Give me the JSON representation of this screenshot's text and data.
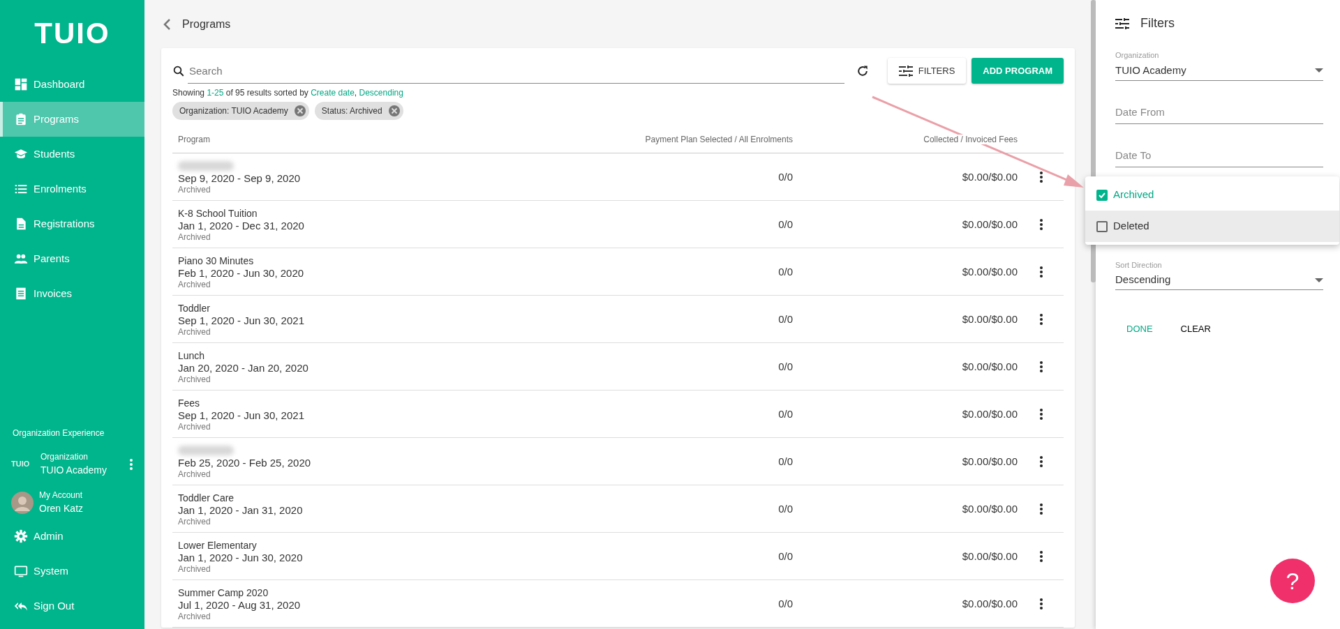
{
  "sidebar": {
    "logo": "TUIO",
    "items": [
      {
        "label": "Dashboard",
        "selected": false
      },
      {
        "label": "Programs",
        "selected": true
      },
      {
        "label": "Students",
        "selected": false
      },
      {
        "label": "Enrolments",
        "selected": false
      },
      {
        "label": "Registrations",
        "selected": false
      },
      {
        "label": "Parents",
        "selected": false
      },
      {
        "label": "Invoices",
        "selected": false
      }
    ],
    "section_title": "Organization Experience",
    "organization": {
      "logo": "TUIO",
      "label": "Organization",
      "name": "TUIO Academy"
    },
    "account": {
      "label": "My Account",
      "name": "Oren Katz"
    },
    "bottom_items": [
      {
        "label": "Admin"
      },
      {
        "label": "System"
      },
      {
        "label": "Sign Out"
      }
    ]
  },
  "header": {
    "title": "Programs"
  },
  "toolbar": {
    "search": {
      "placeholder": "Search"
    },
    "buttons": [
      {
        "label": "FILTERS",
        "kind": "outline"
      },
      {
        "label": "ADD PROGRAM",
        "kind": "primary"
      }
    ]
  },
  "summary": [
    {
      "text": "Showing ",
      "kind": "plain"
    },
    {
      "text": "1-25",
      "kind": "link"
    },
    {
      "text": " of 95 results sorted by ",
      "kind": "plain"
    },
    {
      "text": "Create date",
      "kind": "link"
    },
    {
      "text": ", ",
      "kind": "plain"
    },
    {
      "text": "Descending",
      "kind": "link"
    }
  ],
  "chips": [
    "Organization: TUIO Academy",
    "Status: Archived"
  ],
  "table": {
    "columns": [
      "Program",
      "Payment Plan Selected / All Enrolments",
      "Collected / Invoiced Fees"
    ],
    "rows": [
      {
        "redacted": true,
        "dates": "Sep 9, 2020 - Sep 9, 2020",
        "status": "Archived",
        "enrolments": "0/0",
        "fees": "$0.00/$0.00"
      },
      {
        "redacted": false,
        "name": "K-8 School Tuition",
        "dates": "Jan 1, 2020 - Dec 31, 2020",
        "status": "Archived",
        "enrolments": "0/0",
        "fees": "$0.00/$0.00"
      },
      {
        "redacted": false,
        "name": "Piano 30 Minutes",
        "dates": "Feb 1, 2020 - Jun 30, 2020",
        "status": "Archived",
        "enrolments": "0/0",
        "fees": "$0.00/$0.00"
      },
      {
        "redacted": false,
        "name": "Toddler",
        "dates": "Sep 1, 2020 - Jun 30, 2021",
        "status": "Archived",
        "enrolments": "0/0",
        "fees": "$0.00/$0.00"
      },
      {
        "redacted": false,
        "name": "Lunch",
        "dates": "Jan 20, 2020 - Jan 20, 2020",
        "status": "Archived",
        "enrolments": "0/0",
        "fees": "$0.00/$0.00"
      },
      {
        "redacted": false,
        "name": "Fees",
        "dates": "Sep 1, 2020 - Jun 30, 2021",
        "status": "Archived",
        "enrolments": "0/0",
        "fees": "$0.00/$0.00"
      },
      {
        "redacted": true,
        "dates": "Feb 25, 2020 - Feb 25, 2020",
        "status": "Archived",
        "enrolments": "0/0",
        "fees": "$0.00/$0.00"
      },
      {
        "redacted": false,
        "name": "Toddler Care",
        "dates": "Jan 1, 2020 - Jan 31, 2020",
        "status": "Archived",
        "enrolments": "0/0",
        "fees": "$0.00/$0.00"
      },
      {
        "redacted": false,
        "name": "Lower Elementary",
        "dates": "Jan 1, 2020 - Jun 30, 2020",
        "status": "Archived",
        "enrolments": "0/0",
        "fees": "$0.00/$0.00"
      },
      {
        "redacted": false,
        "name": "Summer Camp 2020",
        "dates": "Jul 1, 2020 - Aug 31, 2020",
        "status": "Archived",
        "enrolments": "0/0",
        "fees": "$0.00/$0.00"
      }
    ]
  },
  "filters": {
    "title": "Filters",
    "fields": [
      {
        "kind": "select",
        "label": "Organization",
        "value": "TUIO Academy"
      },
      {
        "kind": "input",
        "placeholder": "Date From"
      },
      {
        "kind": "input",
        "placeholder": "Date To"
      },
      {
        "kind": "covered"
      },
      {
        "kind": "select",
        "label": "Sort Direction",
        "value": "Descending"
      }
    ],
    "actions": [
      {
        "label": "DONE",
        "kind": "primary"
      },
      {
        "label": "CLEAR",
        "kind": "plain"
      }
    ]
  },
  "status_menu": {
    "options": [
      {
        "label": "Archived",
        "checked": true,
        "highlighted": false
      },
      {
        "label": "Deleted",
        "checked": false,
        "highlighted": true
      }
    ]
  },
  "help_button": {
    "label": "?"
  }
}
